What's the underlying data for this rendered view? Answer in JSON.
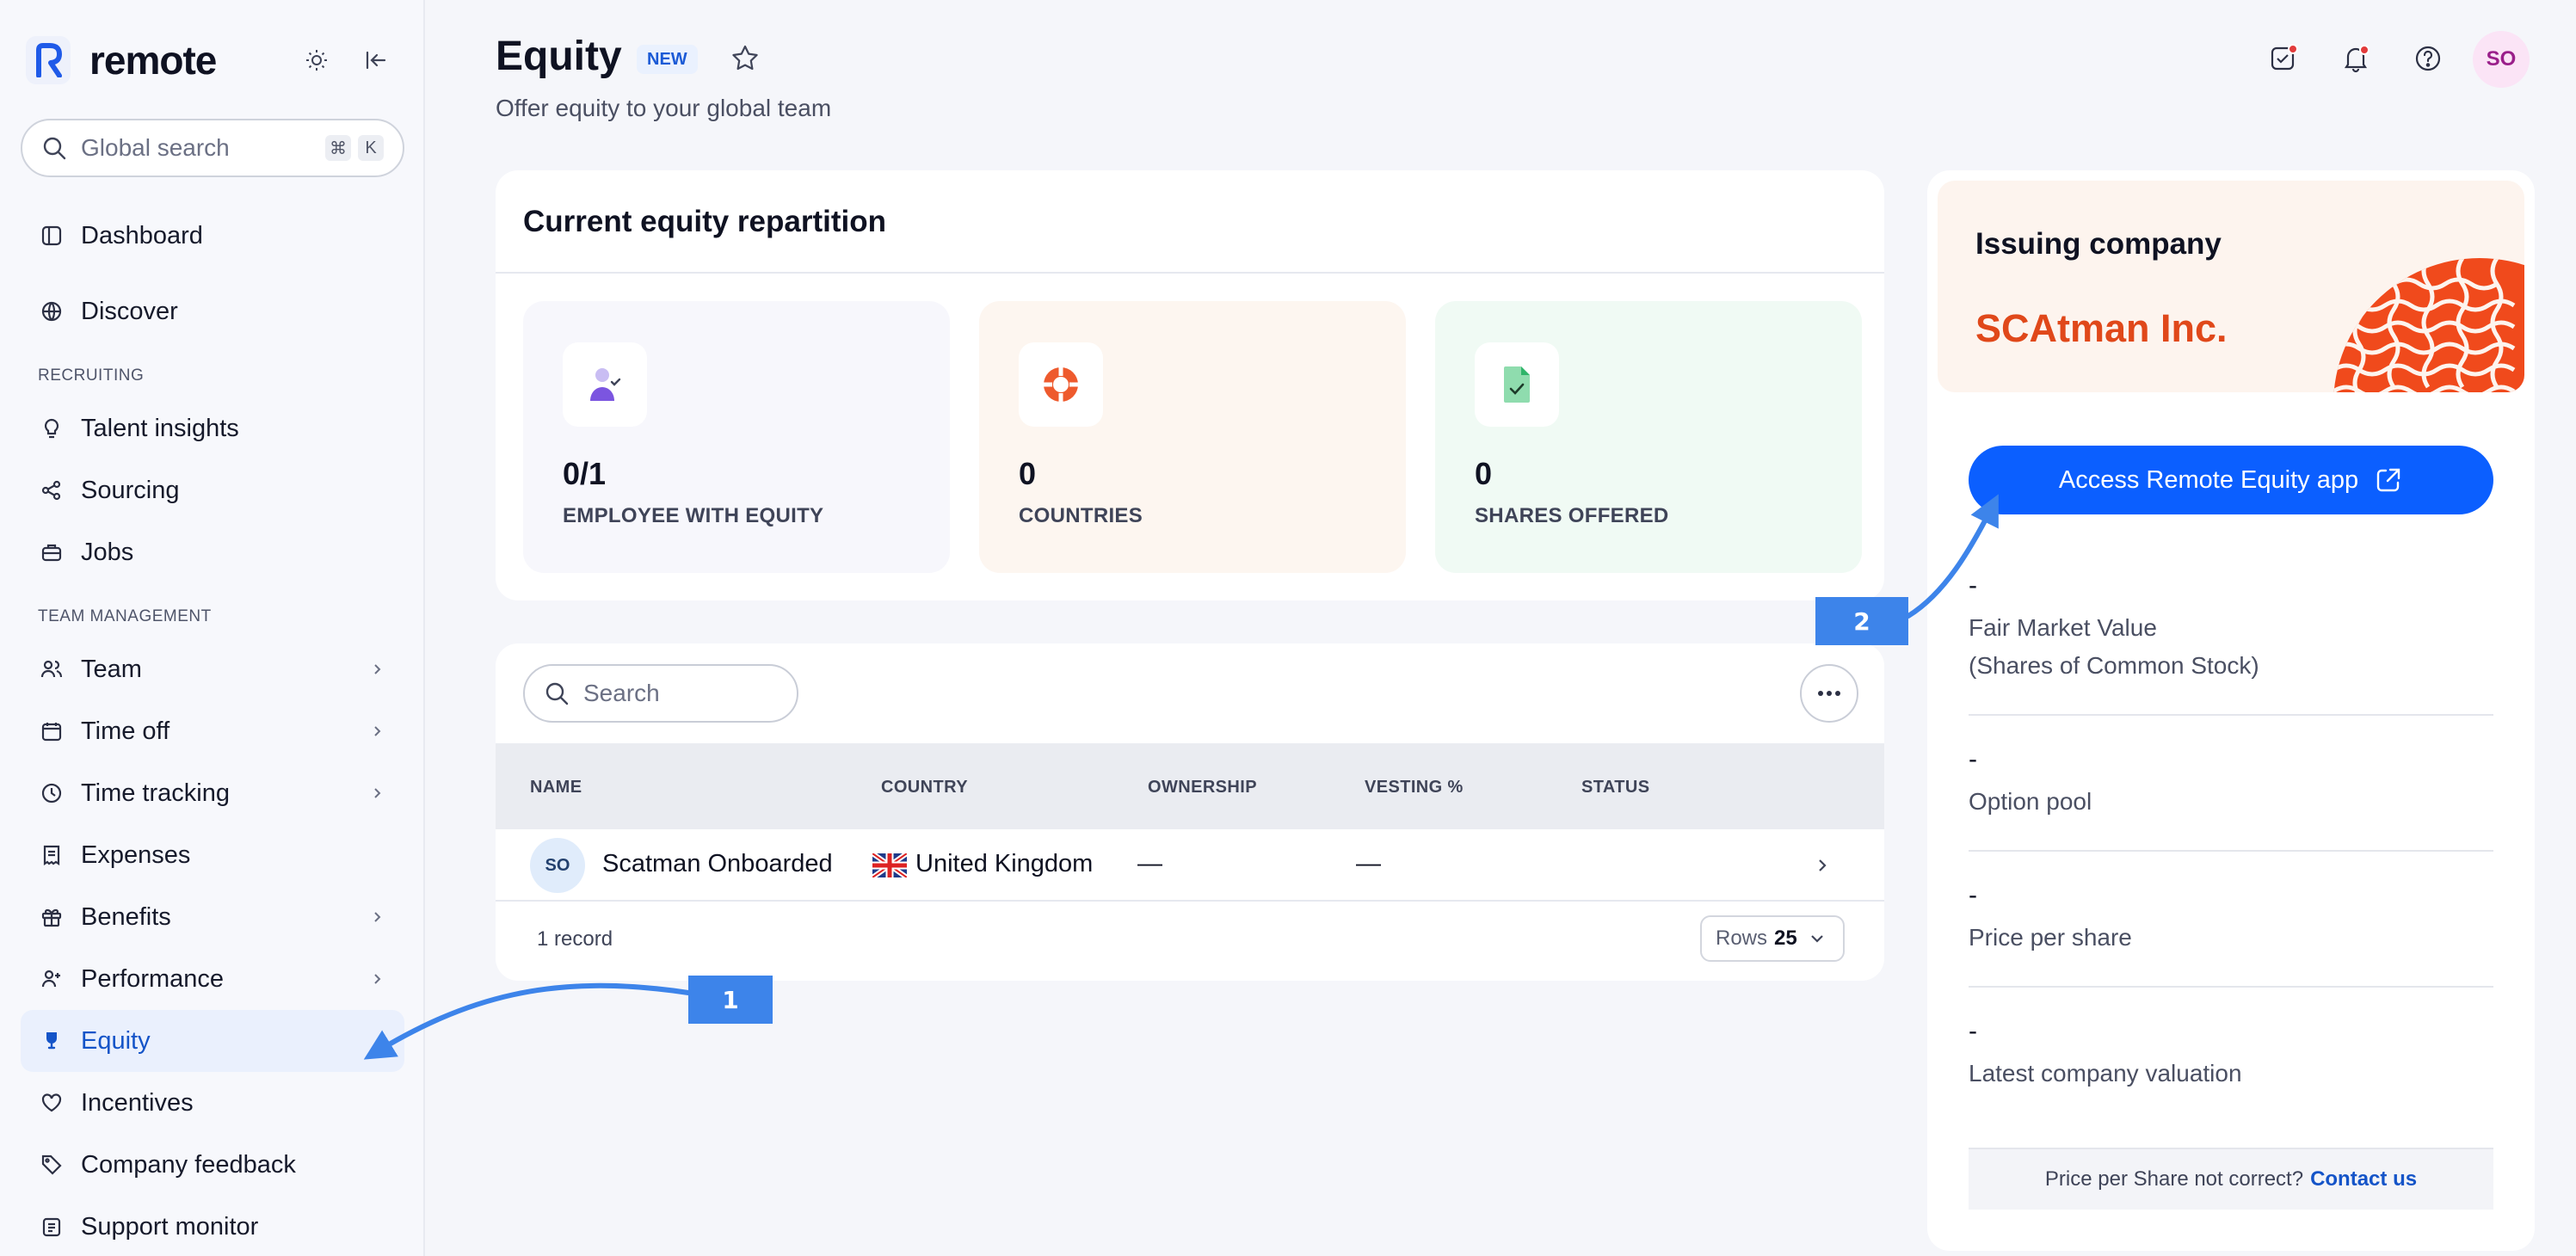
{
  "brand": {
    "name": "remote"
  },
  "search": {
    "placeholder": "Global search",
    "shortcut": [
      "⌘",
      "K"
    ]
  },
  "sidebar": {
    "items": [
      {
        "label": "Dashboard",
        "icon": "layout-icon"
      },
      {
        "label": "Discover",
        "icon": "globe-icon"
      },
      {
        "label": "Talent insights",
        "icon": "lightbulb-icon"
      },
      {
        "label": "Sourcing",
        "icon": "share-icon"
      },
      {
        "label": "Jobs",
        "icon": "briefcase-icon"
      },
      {
        "label": "Team",
        "icon": "users-icon"
      },
      {
        "label": "Time off",
        "icon": "calendar-icon"
      },
      {
        "label": "Time tracking",
        "icon": "clock-icon"
      },
      {
        "label": "Expenses",
        "icon": "receipt-icon"
      },
      {
        "label": "Benefits",
        "icon": "gift-icon"
      },
      {
        "label": "Performance",
        "icon": "user-plus-icon"
      },
      {
        "label": "Equity",
        "icon": "trophy-icon"
      },
      {
        "label": "Incentives",
        "icon": "heart-icon"
      },
      {
        "label": "Company feedback",
        "icon": "tag-icon"
      },
      {
        "label": "Support monitor",
        "icon": "clipboard-icon"
      }
    ],
    "sections": {
      "recruiting": "RECRUITING",
      "team_management": "TEAM MANAGEMENT"
    }
  },
  "header": {
    "title": "Equity",
    "badge": "NEW",
    "subtitle": "Offer equity to your global team",
    "avatar": "SO"
  },
  "repartition": {
    "title": "Current equity repartition",
    "stats": [
      {
        "value": "0/1",
        "label": "EMPLOYEE WITH EQUITY",
        "bg": "#f7f7fc"
      },
      {
        "value": "0",
        "label": "COUNTRIES",
        "bg": "#fdf6f0"
      },
      {
        "value": "0",
        "label": "SHARES OFFERED",
        "bg": "#f0faf4"
      }
    ]
  },
  "table": {
    "search_placeholder": "Search",
    "columns": [
      "NAME",
      "COUNTRY",
      "OWNERSHIP",
      "VESTING %",
      "STATUS"
    ],
    "rows": [
      {
        "initials": "SO",
        "name": "Scatman Onboarded",
        "country": "United Kingdom",
        "ownership": "—",
        "vesting": "—",
        "status": ""
      }
    ],
    "record_count": "1 record",
    "rows_label": "Rows",
    "rows_value": "25"
  },
  "issuer": {
    "label": "Issuing company",
    "company": "SCAtman Inc.",
    "button": "Access Remote Equity app",
    "fields": [
      {
        "value": "-",
        "label": "Fair Market Value\n(Shares of Common Stock)"
      },
      {
        "value": "-",
        "label": "Option pool"
      },
      {
        "value": "-",
        "label": "Price per share"
      },
      {
        "value": "-",
        "label": "Latest company valuation"
      }
    ],
    "footer_text": "Price per Share not correct?",
    "footer_link": "Contact us"
  },
  "annotations": [
    "1",
    "2"
  ],
  "colors": {
    "accent": "#0b5fff",
    "brand_orange": "#e0481a",
    "callout": "#3d84ea"
  }
}
